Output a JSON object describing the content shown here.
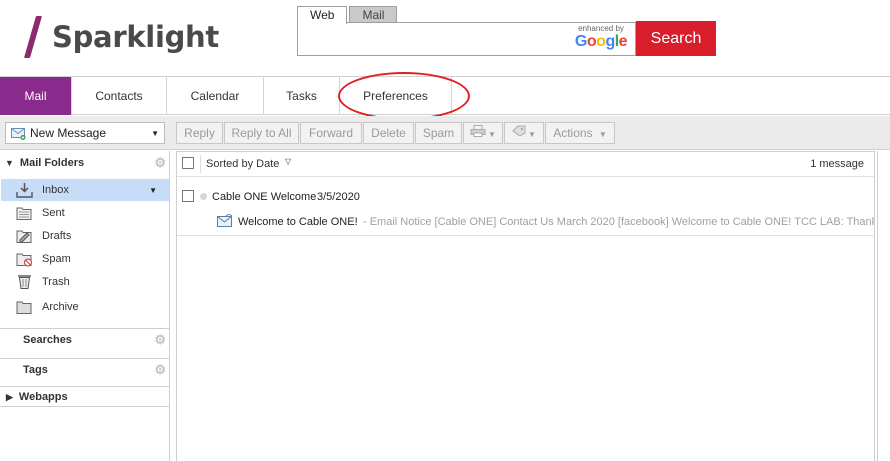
{
  "brand": {
    "name": "Sparklight"
  },
  "search": {
    "tabs": [
      "Web",
      "Mail"
    ],
    "enhanced_by": "enhanced by",
    "google": "Google",
    "button": "Search"
  },
  "nav": {
    "tabs": [
      "Mail",
      "Contacts",
      "Calendar",
      "Tasks",
      "Preferences"
    ]
  },
  "toolbar": {
    "new_message": "New Message",
    "buttons": [
      "Reply",
      "Reply to All",
      "Forward",
      "Delete",
      "Spam"
    ],
    "actions": "Actions"
  },
  "sidebar": {
    "mail_folders": "Mail Folders",
    "folders": [
      "Inbox",
      "Sent",
      "Drafts",
      "Spam",
      "Trash",
      "Archive"
    ],
    "searches": "Searches",
    "tags": "Tags",
    "webapps": "Webapps"
  },
  "list": {
    "sort_label": "Sorted by Date",
    "count": "1 message",
    "conversation": {
      "sender": "Cable ONE Welcome",
      "date": "3/5/2020"
    },
    "message": {
      "subject": "Welcome to Cable ONE!",
      "snippet": "- Email Notice [Cable ONE] Contact Us March 2020 [facebook] Welcome to Cable ONE! TCC LAB: Thank yo"
    }
  },
  "colors": {
    "brand_purple": "#8b2a8d",
    "search_red": "#d81e2a",
    "selection_blue": "#c6dcf7",
    "annotation_red": "#e02020"
  },
  "icons": [
    "new-message-icon",
    "print-icon",
    "tag-icon",
    "inbox-icon",
    "sent-icon",
    "drafts-icon",
    "spam-icon",
    "trash-icon",
    "archive-icon",
    "gear-icon",
    "envelope-icon"
  ]
}
